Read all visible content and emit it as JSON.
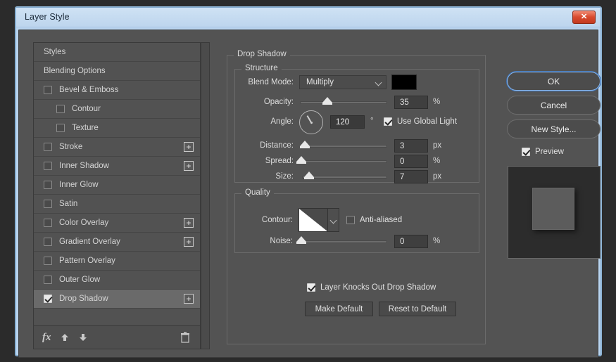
{
  "window": {
    "title": "Layer Style",
    "close_label": "✕"
  },
  "styles_panel": {
    "items": [
      {
        "label": "Styles",
        "type": "plain",
        "checkbox": null,
        "plus": false,
        "selected": false
      },
      {
        "label": "Blending Options",
        "type": "plain",
        "checkbox": null,
        "plus": false,
        "selected": false
      },
      {
        "label": "Bevel & Emboss",
        "type": "lvl0",
        "checkbox": false,
        "plus": false,
        "selected": false
      },
      {
        "label": "Contour",
        "type": "lvl1",
        "checkbox": false,
        "plus": false,
        "selected": false
      },
      {
        "label": "Texture",
        "type": "lvl1",
        "checkbox": false,
        "plus": false,
        "selected": false
      },
      {
        "label": "Stroke",
        "type": "lvl0",
        "checkbox": false,
        "plus": true,
        "selected": false
      },
      {
        "label": "Inner Shadow",
        "type": "lvl0",
        "checkbox": false,
        "plus": true,
        "selected": false
      },
      {
        "label": "Inner Glow",
        "type": "lvl0",
        "checkbox": false,
        "plus": false,
        "selected": false
      },
      {
        "label": "Satin",
        "type": "lvl0",
        "checkbox": false,
        "plus": false,
        "selected": false
      },
      {
        "label": "Color Overlay",
        "type": "lvl0",
        "checkbox": false,
        "plus": true,
        "selected": false
      },
      {
        "label": "Gradient Overlay",
        "type": "lvl0",
        "checkbox": false,
        "plus": true,
        "selected": false
      },
      {
        "label": "Pattern Overlay",
        "type": "lvl0",
        "checkbox": false,
        "plus": false,
        "selected": false
      },
      {
        "label": "Outer Glow",
        "type": "lvl0",
        "checkbox": false,
        "plus": false,
        "selected": false
      },
      {
        "label": "Drop Shadow",
        "type": "lvl0",
        "checkbox": true,
        "plus": true,
        "selected": true
      }
    ],
    "toolbar": {
      "fx_icon": "fx",
      "move_up_icon": "⬆",
      "move_down_icon": "⬇",
      "delete_icon": "🗑"
    }
  },
  "options": {
    "group_title": "Drop Shadow",
    "structure": {
      "title": "Structure",
      "blend_mode_label": "Blend Mode:",
      "blend_mode_value": "Multiply",
      "blend_color": "#000000",
      "opacity_label": "Opacity:",
      "opacity_value": "35",
      "opacity_unit": "%",
      "angle_label": "Angle:",
      "angle_value": "120",
      "angle_unit": "°",
      "use_global_light_label": "Use Global Light",
      "use_global_light_checked": true,
      "distance_label": "Distance:",
      "distance_value": "3",
      "distance_unit": "px",
      "spread_label": "Spread:",
      "spread_value": "0",
      "spread_unit": "%",
      "size_label": "Size:",
      "size_value": "7",
      "size_unit": "px"
    },
    "quality": {
      "title": "Quality",
      "contour_label": "Contour:",
      "anti_aliased_label": "Anti-aliased",
      "anti_aliased_checked": false,
      "noise_label": "Noise:",
      "noise_value": "0",
      "noise_unit": "%"
    },
    "knockout_label": "Layer Knocks Out Drop Shadow",
    "knockout_checked": true,
    "make_default_label": "Make Default",
    "reset_default_label": "Reset to Default"
  },
  "actions": {
    "ok_label": "OK",
    "cancel_label": "Cancel",
    "new_style_label": "New Style...",
    "preview_label": "Preview",
    "preview_checked": true
  },
  "colors": {
    "title_bar": "#c3d9f0",
    "dialog_body": "#535353",
    "panel": "#4e4e4e",
    "selected_row": "#6a6a6a",
    "accent_focus": "#3f74b8",
    "close_button": "#d94b2e"
  }
}
